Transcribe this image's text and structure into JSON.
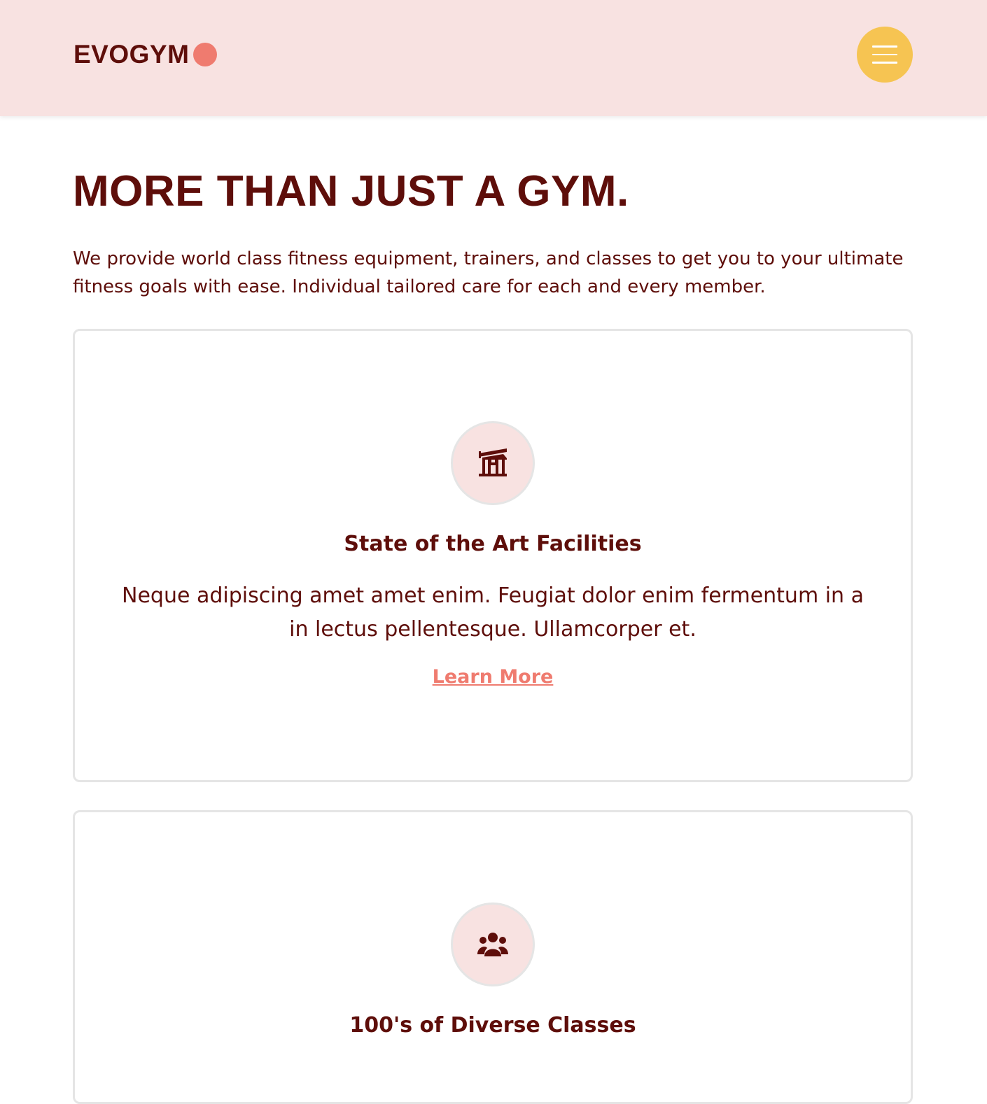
{
  "navbar": {
    "logo_text": "EVOGYM",
    "menu_icon": "hamburger-menu-icon",
    "colors": {
      "background": "#f8e2e1",
      "menu_button": "#f6c452",
      "logo_dot": "#ef7b6f"
    }
  },
  "hero": {
    "title": "MORE THAN JUST A GYM.",
    "description": "We provide world class fitness equipment, trainers, and classes to get you to your ultimate fitness goals with ease. Individual tailored care for each and every member."
  },
  "benefits": [
    {
      "icon": "home-modern-icon",
      "title": "State of the Art Facilities",
      "description": "Neque adipiscing amet amet enim. Feugiat dolor enim fermentum in a in lectus pellentesque. Ullamcorper et.",
      "link": "Learn More"
    },
    {
      "icon": "user-group-icon",
      "title": "100's of Diverse Classes"
    }
  ],
  "colors": {
    "primary_text": "#5e0e0a",
    "accent": "#ef7b6f",
    "card_border": "#e5e5e5"
  }
}
